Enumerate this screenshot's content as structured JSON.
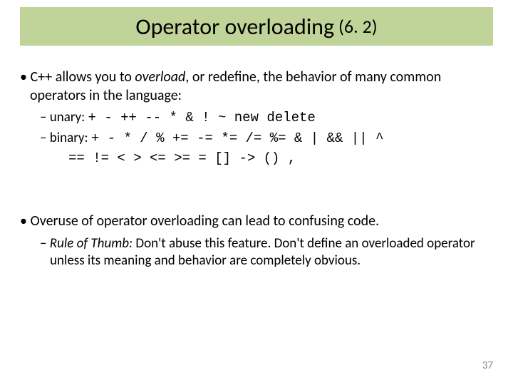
{
  "title": {
    "main": "Operator overloading",
    "section": "(6. 2)"
  },
  "content": {
    "intro_pre": "C++ allows you to ",
    "intro_overload": "overload",
    "intro_post": ", or redefine, the behavior of many common operators in the language:",
    "unary_label": "unary: ",
    "unary_ops": "+ - ++ -- * & ! ~ new delete",
    "binary_label": "binary: ",
    "binary_ops1": "+ - * / % += -= *= /= %= & | && || ^",
    "binary_ops2": "== != < > <= >= = [] -> () ,",
    "overuse": "Overuse of operator overloading can lead to confusing code.",
    "rule_label": "Rule of Thumb:",
    "rule_text": " Don't abuse this feature.  Don't define an overloaded operator unless its meaning and behavior are completely obvious."
  },
  "page": "37"
}
